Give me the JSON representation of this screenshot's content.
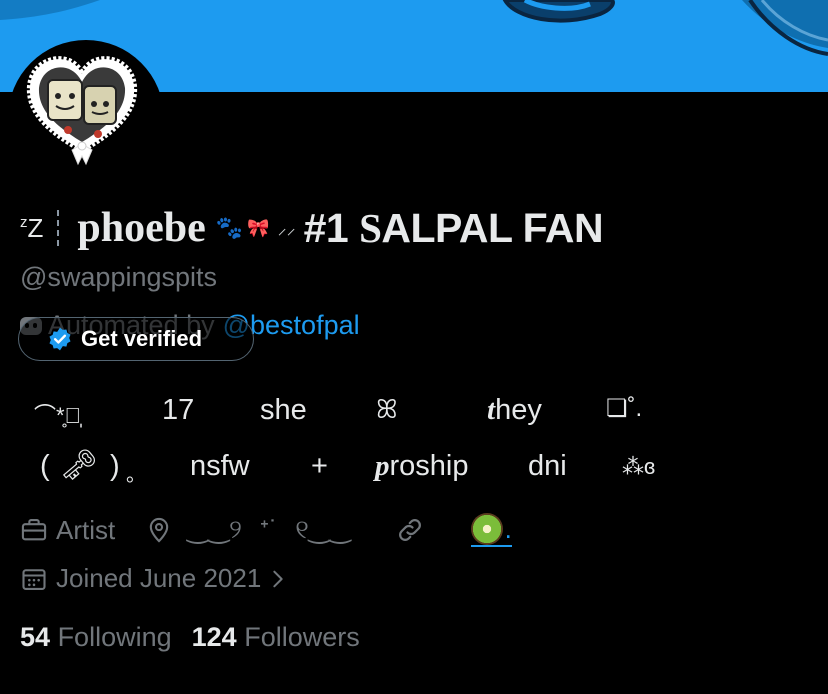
{
  "profile": {
    "sleep_glyph_small": "z",
    "sleep_glyph_large": "Z",
    "display_name": "phoebe",
    "name_tag_hash": "#1 ",
    "name_tag_s": "S",
    "name_tag_rest": "ALPAL FAN",
    "handle": "@swappingspits",
    "automated_label": "Automated by",
    "automated_link": "@bestofpal",
    "get_verified_label": "Get verified"
  },
  "bio": {
    "line1": {
      "deco_left": "⌒*̥⃝̩",
      "age": "17",
      "pronoun1": "she",
      "deco_mid": "ꕤ",
      "pronoun2_first": "t",
      "pronoun2_rest": "hey",
      "deco_right": "❏˚."
    },
    "line2": {
      "key_open": "(",
      "key_close": ")",
      "key_dot": "。",
      "nsfw": "nsfw",
      "plus": "+",
      "proship_first": "p",
      "proship_rest": "roship",
      "dni": "dni",
      "deco_end": "ɞ"
    }
  },
  "meta": {
    "profession": "Artist",
    "location_text": "‿‿୨",
    "location_deco": "ᕀ˙",
    "location_text2": "୧‿‿",
    "website_text": "."
  },
  "joined": "Joined June 2021",
  "stats": {
    "following_count": "54",
    "following_label": "Following",
    "followers_count": "124",
    "followers_label": "Followers"
  },
  "colors": {
    "banner": "#1d9bf0",
    "link": "#1d9bf0",
    "muted": "#71767b",
    "text": "#e7e9ea",
    "background": "#000000"
  },
  "icons": [
    "briefcase-icon",
    "location-pin-icon",
    "link-icon",
    "calendar-icon",
    "chevron-right-icon",
    "verified-badge-icon",
    "bot-icon",
    "kiwi-emoji-icon",
    "paw-icon",
    "bow-icon",
    "key-emoji-icon"
  ]
}
